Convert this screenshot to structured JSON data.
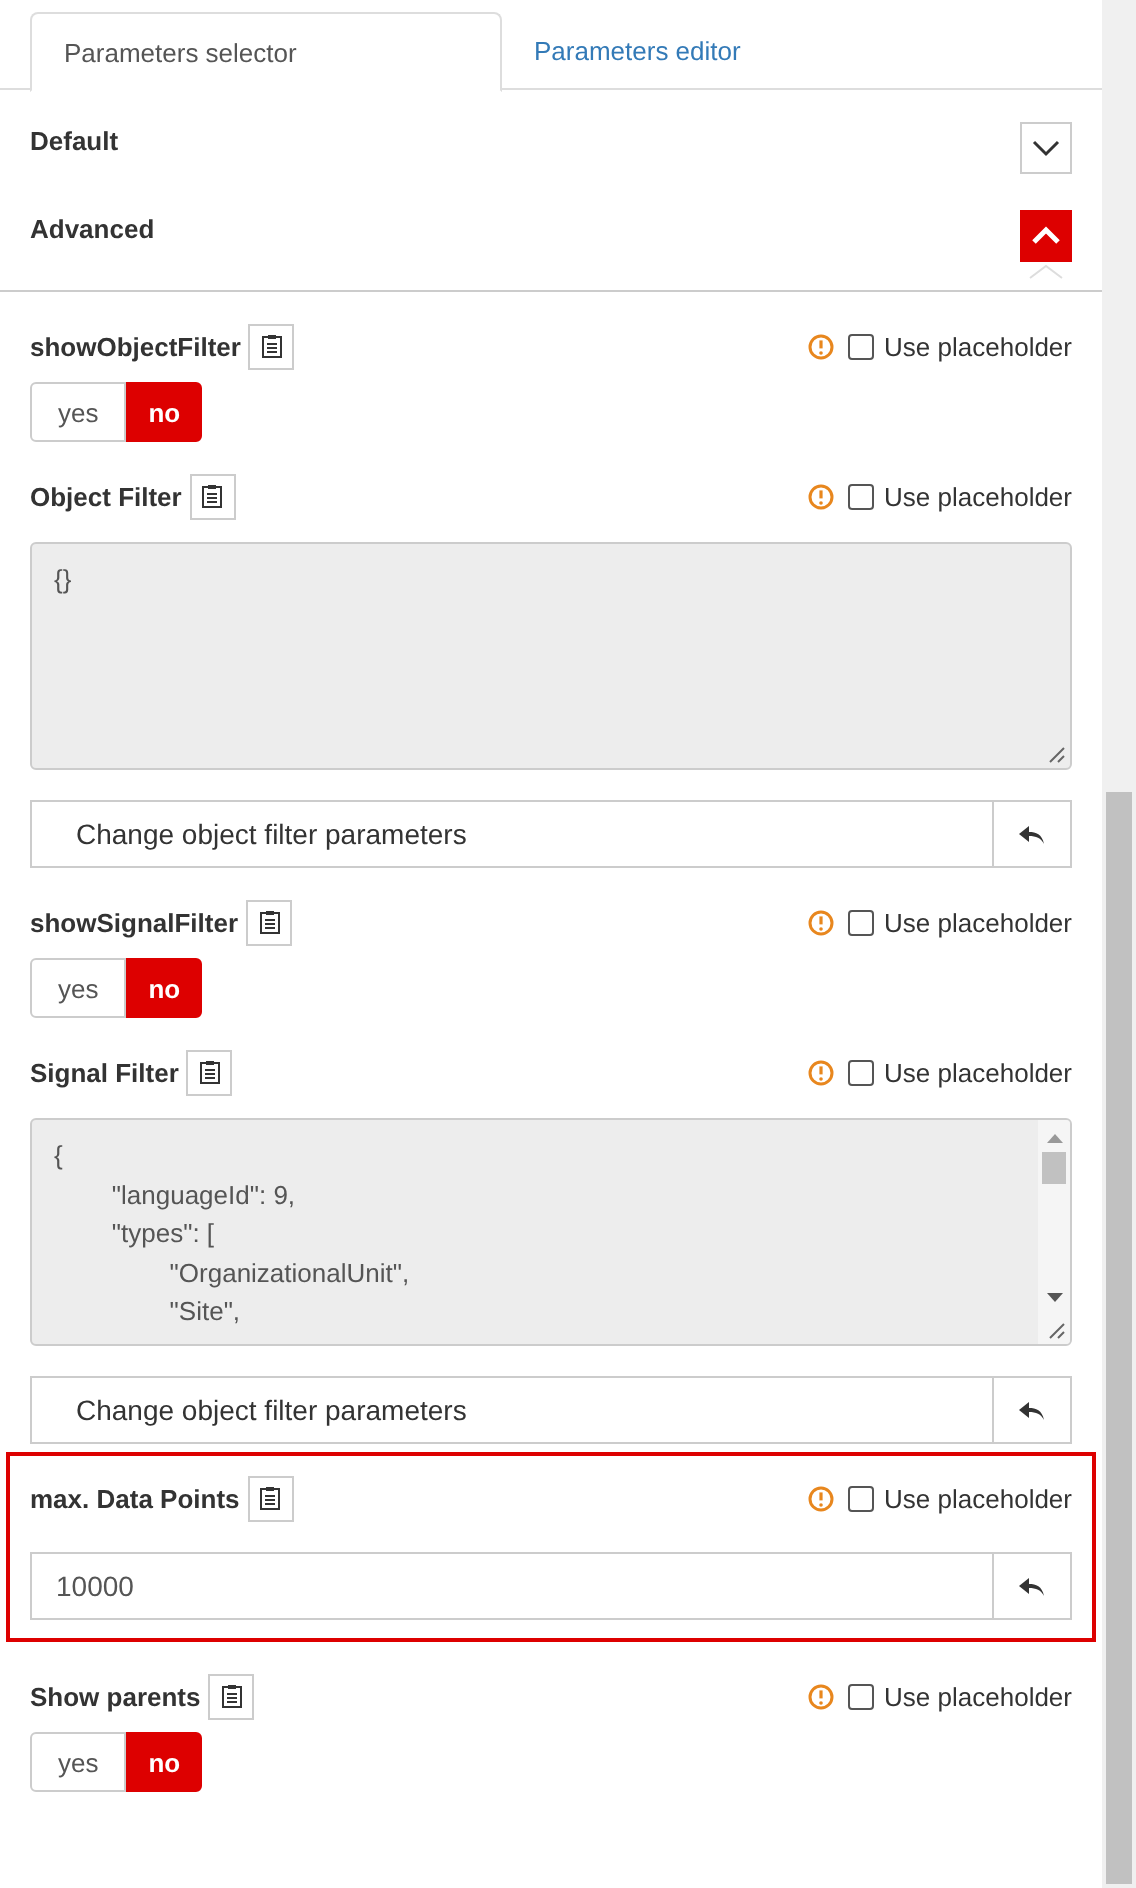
{
  "tabs": [
    {
      "label": "Parameters selector",
      "selected": true
    },
    {
      "label": "Parameters editor",
      "selected": false
    }
  ],
  "sections": [
    {
      "title": "Default",
      "expanded": false
    },
    {
      "title": "Advanced",
      "expanded": true
    }
  ],
  "parameters": [
    {
      "kind": "toggle",
      "label": "showObjectFilter",
      "placeholder_label": "Use placeholder",
      "use_placeholder": false,
      "highlighted": false,
      "options": [
        {
          "label": "yes",
          "selected": false
        },
        {
          "label": "no",
          "selected": true
        }
      ]
    },
    {
      "kind": "textarea",
      "label": "Object Filter",
      "placeholder_label": "Use placeholder",
      "use_placeholder": false,
      "highlighted": false,
      "value": "{}",
      "button": "Change object filter parameters"
    },
    {
      "kind": "toggle",
      "label": "showSignalFilter",
      "placeholder_label": "Use placeholder",
      "use_placeholder": false,
      "highlighted": false,
      "options": [
        {
          "label": "yes",
          "selected": false
        },
        {
          "label": "no",
          "selected": true
        }
      ]
    },
    {
      "kind": "textarea",
      "label": "Signal Filter",
      "placeholder_label": "Use placeholder",
      "use_placeholder": false,
      "highlighted": false,
      "value": "{\n\t\"languageId\": 9,\n\t\"types\": [\n\t\t\"OrganizationalUnit\",\n\t\t\"Site\",",
      "button": "Change object filter parameters"
    },
    {
      "kind": "number",
      "label": "max. Data Points",
      "placeholder_label": "Use placeholder",
      "use_placeholder": false,
      "highlighted": true,
      "value": "10000"
    },
    {
      "kind": "toggle",
      "label": "Show parents",
      "placeholder_label": "Use placeholder",
      "use_placeholder": false,
      "highlighted": false,
      "options": [
        {
          "label": "yes",
          "selected": false
        },
        {
          "label": "no",
          "selected": true
        }
      ]
    }
  ]
}
